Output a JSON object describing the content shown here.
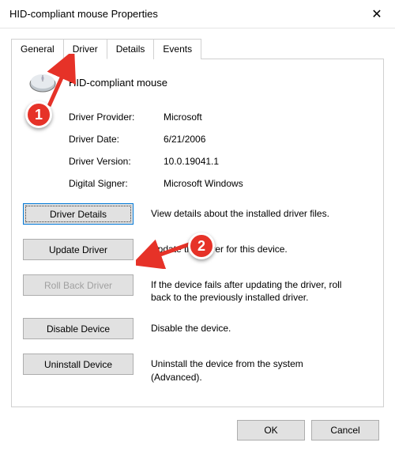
{
  "window": {
    "title": "HID-compliant mouse Properties",
    "close_icon": "✕"
  },
  "tabs": {
    "general": "General",
    "driver": "Driver",
    "details": "Details",
    "events": "Events"
  },
  "device": {
    "name": "HID-compliant mouse"
  },
  "info": {
    "provider_label": "Driver Provider:",
    "provider_value": "Microsoft",
    "date_label": "Driver Date:",
    "date_value": "6/21/2006",
    "version_label": "Driver Version:",
    "version_value": "10.0.19041.1",
    "signer_label": "Digital Signer:",
    "signer_value": "Microsoft Windows"
  },
  "buttons": {
    "details": {
      "label": "Driver Details",
      "desc": "View details about the installed driver files."
    },
    "update": {
      "label": "Update Driver",
      "desc": "Update the driver for this device."
    },
    "rollback": {
      "label": "Roll Back Driver",
      "desc": "If the device fails after updating the driver, roll back to the previously installed driver."
    },
    "disable": {
      "label": "Disable Device",
      "desc": "Disable the device."
    },
    "uninstall": {
      "label": "Uninstall Device",
      "desc": "Uninstall the device from the system (Advanced)."
    }
  },
  "footer": {
    "ok": "OK",
    "cancel": "Cancel"
  },
  "annotations": {
    "badge1": "1",
    "badge2": "2"
  }
}
